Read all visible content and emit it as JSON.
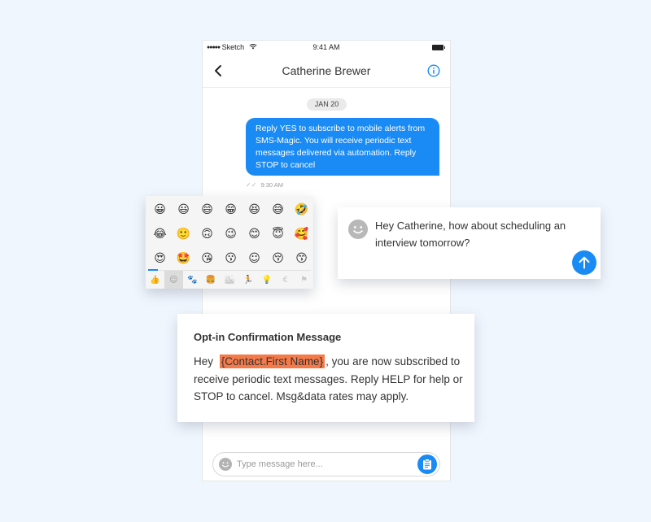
{
  "status_bar": {
    "carrier": "Sketch",
    "time": "9:41 AM"
  },
  "header": {
    "title": "Catherine Brewer",
    "back_icon": "chevron-left-icon",
    "info_icon": "info-icon"
  },
  "conversation": {
    "date_label": "JAN 20",
    "messages": [
      {
        "direction": "outgoing",
        "text": "Reply YES to subscribe to mobile alerts from SMS-Magic. You will receive periodic text messages delivered via automation. Reply STOP to cancel",
        "time": "9:30 AM",
        "status_icon": "double-check-icon"
      }
    ]
  },
  "composer": {
    "placeholder": "Type message here...",
    "value": "",
    "emoji_icon": "smiley-icon",
    "template_icon": "clipboard-icon"
  },
  "emoji_picker": {
    "emojis": [
      "😀",
      "😃",
      "😄",
      "😁",
      "😆",
      "😅",
      "🤣",
      "😂",
      "🙂",
      "🙃",
      "😉",
      "😊",
      "😇",
      "🥰",
      "😍",
      "🤩",
      "😘",
      "😗",
      "☺",
      "😚",
      "😙"
    ],
    "categories": [
      {
        "name": "recent",
        "glyph": "👍",
        "active": false
      },
      {
        "name": "smileys",
        "glyph": "☺",
        "active": true
      },
      {
        "name": "animals",
        "glyph": "🐾",
        "active": false
      },
      {
        "name": "food",
        "glyph": "🍔",
        "active": false
      },
      {
        "name": "travel",
        "glyph": "🏙",
        "active": false
      },
      {
        "name": "activity",
        "glyph": "🏃",
        "active": false
      },
      {
        "name": "objects",
        "glyph": "💡",
        "active": false
      },
      {
        "name": "symbols",
        "glyph": "€",
        "active": false
      },
      {
        "name": "flags",
        "glyph": "⚑",
        "active": false
      }
    ]
  },
  "reply_card": {
    "text": "Hey Catherine, how about scheduling an interview tomorrow?",
    "send_icon": "arrow-up-icon"
  },
  "optin_card": {
    "heading": "Opt-in Confirmation Message",
    "prefix": "Hey",
    "merge_field": "{Contact.First Name}",
    "suffix": ", you are now subscribed to receive periodic text messages. Reply HELP for help or STOP to cancel. Msg&data rates may apply.",
    "merge_highlight_color": "#f47a4a"
  },
  "colors": {
    "accent": "#1a8bf5",
    "background": "#f0f6fe"
  }
}
